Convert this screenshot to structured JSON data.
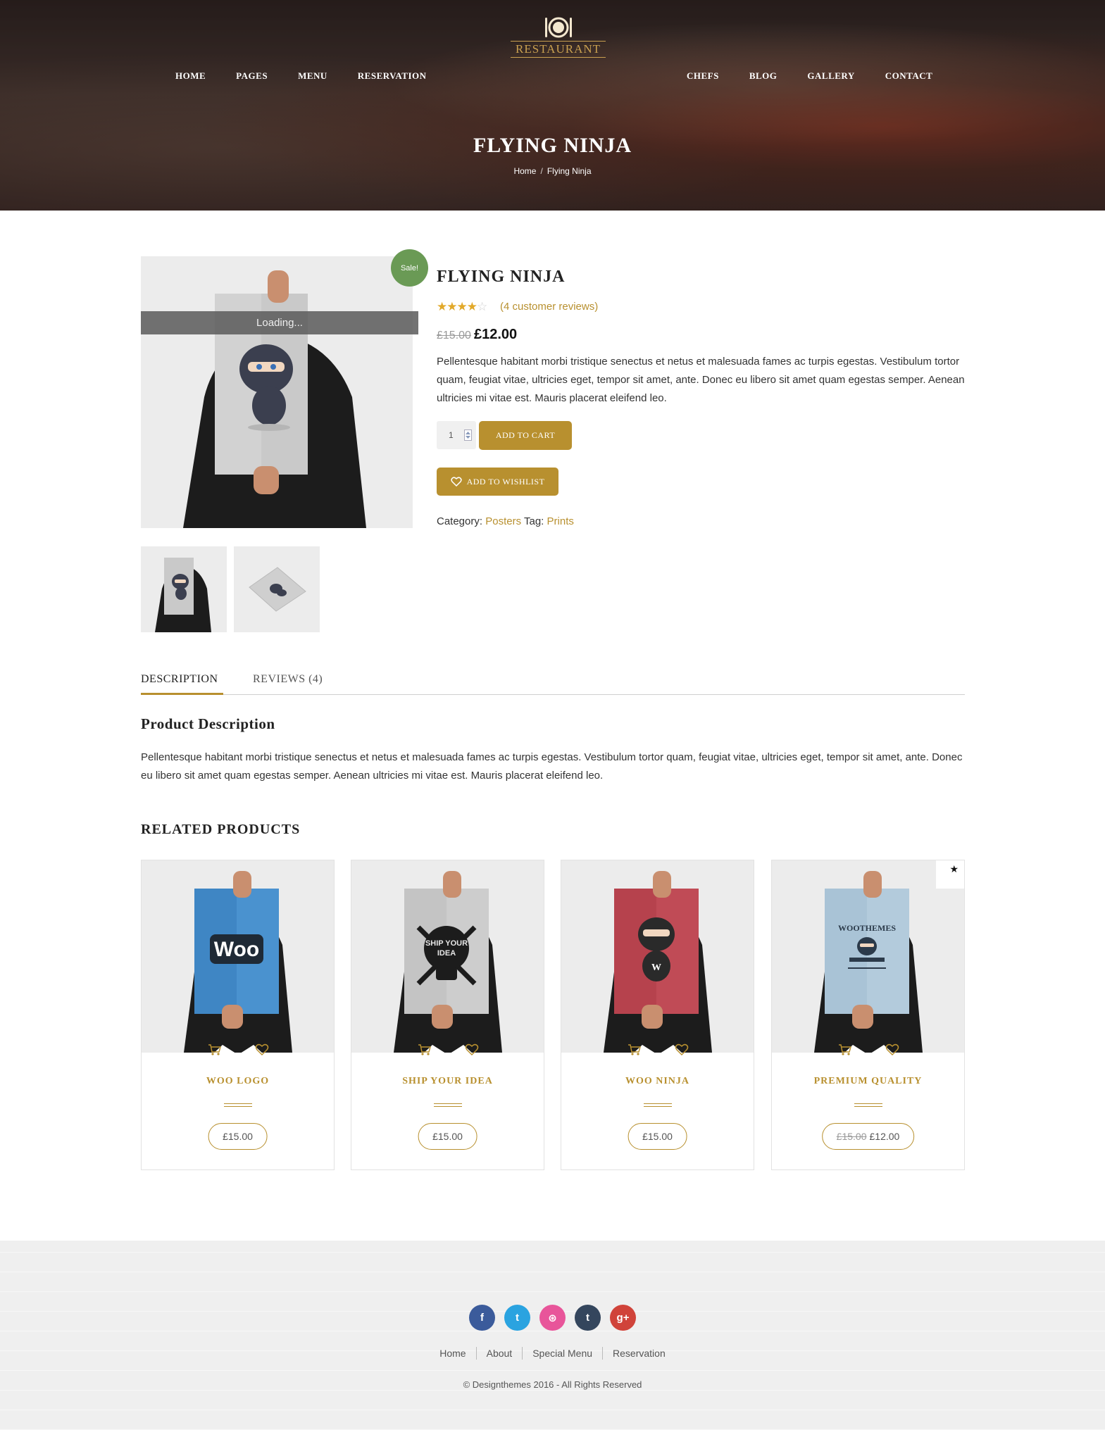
{
  "brand": {
    "name": "RESTAURANT"
  },
  "nav": {
    "left": [
      "HOME",
      "PAGES",
      "MENU",
      "RESERVATION"
    ],
    "right": [
      "CHEFS",
      "BLOG",
      "GALLERY",
      "CONTACT"
    ]
  },
  "hero": {
    "title": "FLYING NINJA",
    "breadcrumb": [
      "Home",
      "Flying Ninja"
    ],
    "separator": "/"
  },
  "product": {
    "title": "FLYING NINJA",
    "sale_badge": "Sale!",
    "loading": "Loading...",
    "rating": 4,
    "rating_max": 5,
    "reviews_link": "(4 customer reviews)",
    "old_price": "£15.00",
    "price": "£12.00",
    "description": "Pellentesque habitant morbi tristique senectus et netus et malesuada fames ac turpis egestas. Vestibulum tortor quam, feugiat vitae, ultricies eget, tempor sit amet, ante. Donec eu libero sit amet quam egestas semper. Aenean ultricies mi vitae est. Mauris placerat eleifend leo.",
    "quantity": "1",
    "add_to_cart": "ADD TO CART",
    "add_to_wishlist": "ADD TO WISHLIST",
    "category_label": "Category:",
    "category": "Posters",
    "tag_label": "Tag:",
    "tag": "Prints"
  },
  "tabs": [
    {
      "label": "DESCRIPTION",
      "active": true
    },
    {
      "label": "REVIEWS (4)",
      "active": false
    }
  ],
  "description_section": {
    "title": "Product Description",
    "text": "Pellentesque habitant morbi tristique senectus et netus et malesuada fames ac turpis egestas. Vestibulum tortor quam, feugiat vitae, ultricies eget, tempor sit amet, ante. Donec eu libero sit amet quam egestas semper. Aenean ultricies mi vitae est. Mauris placerat eleifend leo."
  },
  "related": {
    "title": "RELATED PRODUCTS",
    "items": [
      {
        "name": "WOO LOGO",
        "price": "£15.00",
        "old_price": "",
        "poster_color": "#3f86c4",
        "poster_text": "Woo"
      },
      {
        "name": "SHIP YOUR IDEA",
        "price": "£15.00",
        "old_price": "",
        "poster_color": "#c4c4c4",
        "poster_text": "SHIP YOUR IDEA"
      },
      {
        "name": "WOO NINJA",
        "price": "£15.00",
        "old_price": "",
        "poster_color": "#b6424d",
        "poster_text": "W"
      },
      {
        "name": "PREMIUM QUALITY",
        "price": "£12.00",
        "old_price": "£15.00",
        "poster_color": "#a9c3d6",
        "poster_text": "WOOTHEMES"
      }
    ]
  },
  "footer": {
    "socials": [
      {
        "name": "facebook",
        "glyph": "f",
        "color": "#3b5b9b"
      },
      {
        "name": "twitter",
        "glyph": "t",
        "color": "#2aa3e0"
      },
      {
        "name": "dribbble",
        "glyph": "⊛",
        "color": "#e8559a"
      },
      {
        "name": "tumblr",
        "glyph": "t",
        "color": "#34465d"
      },
      {
        "name": "google-plus",
        "glyph": "g+",
        "color": "#d0433a"
      }
    ],
    "links": [
      "Home",
      "About",
      "Special Menu",
      "Reservation"
    ],
    "copyright": "© Designthemes 2016 - All Rights Reserved"
  },
  "colors": {
    "accent": "#b8902f",
    "sale": "#6a9a55",
    "star": "#e2a92a"
  }
}
